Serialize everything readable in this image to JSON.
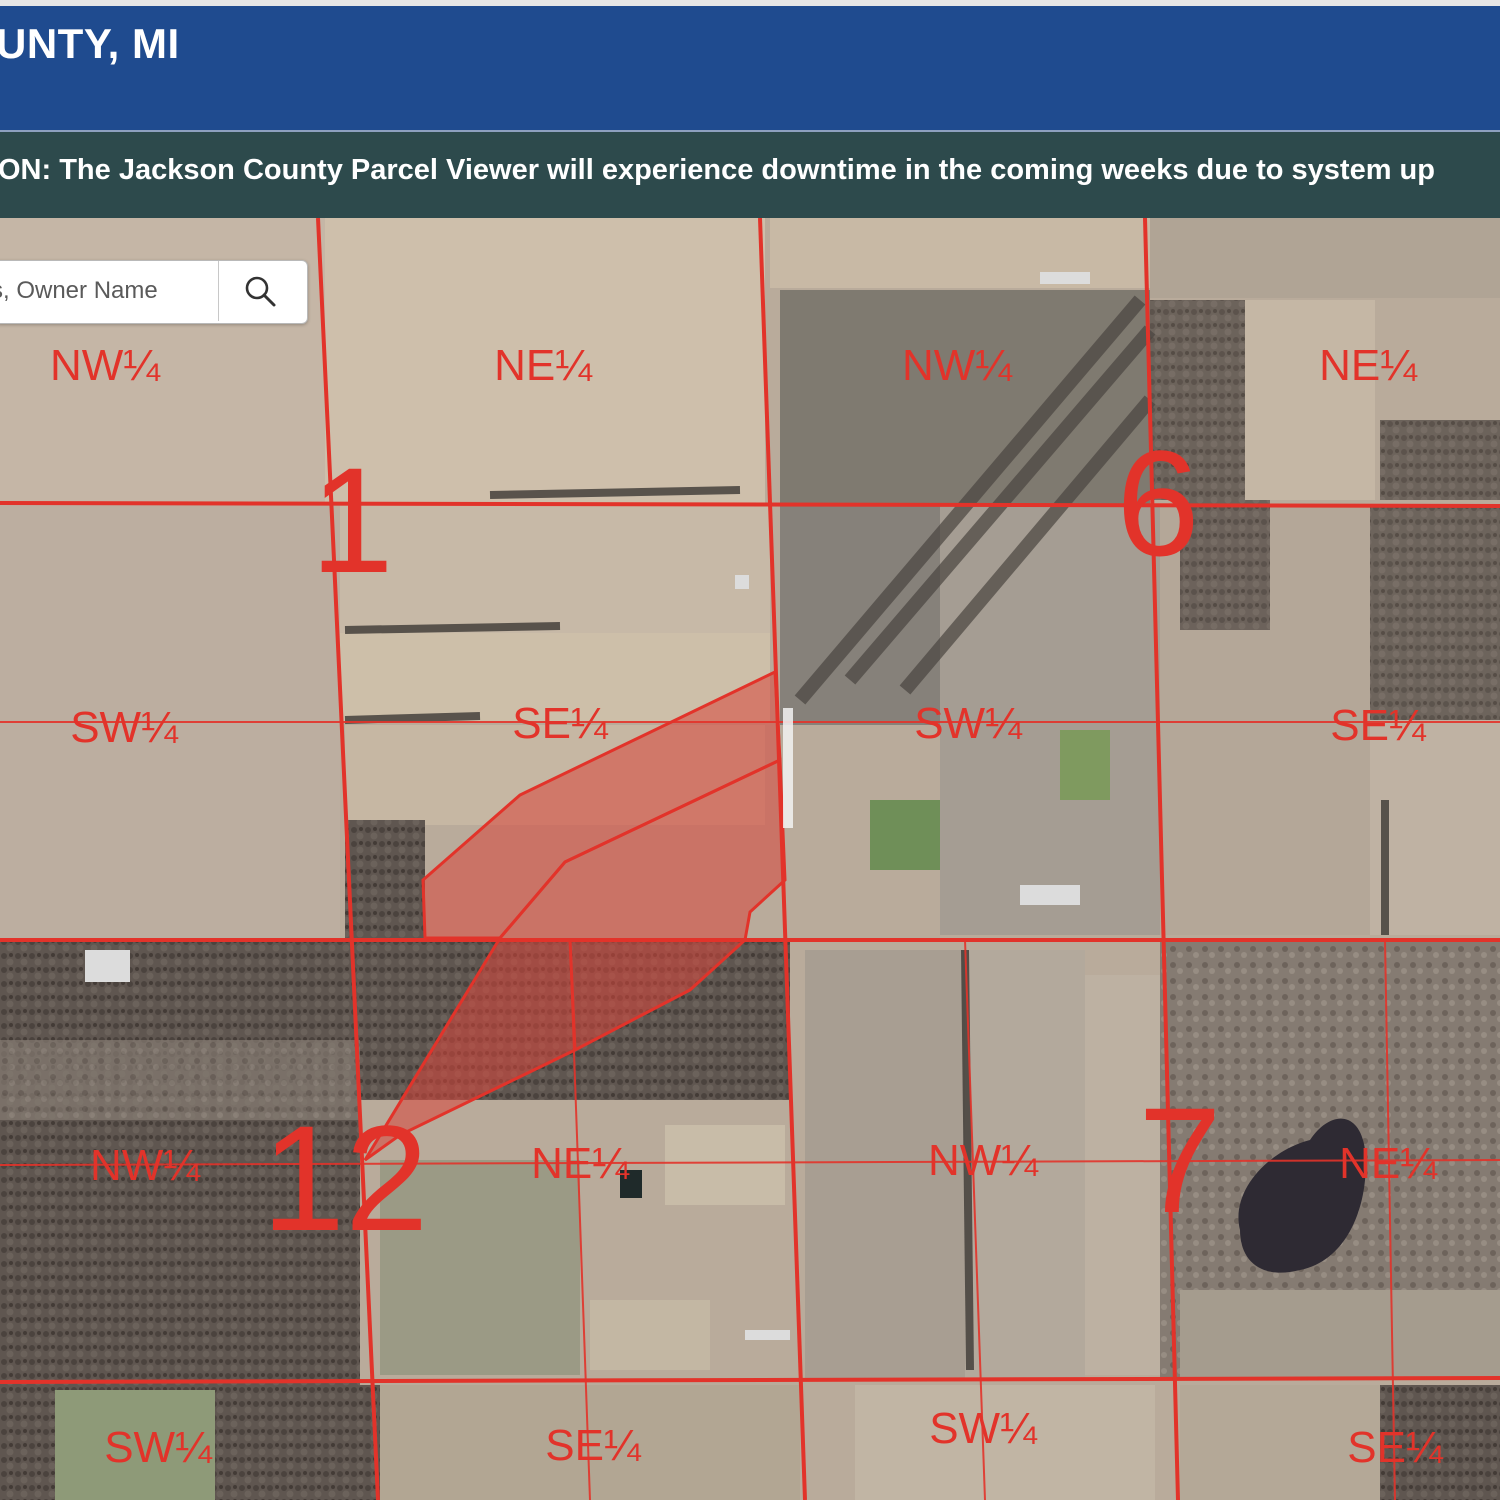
{
  "header": {
    "title": "UNTY, MI"
  },
  "notice": {
    "text": "ON: The Jackson County Parcel Viewer will experience downtime in the coming weeks due to system up"
  },
  "search": {
    "placeholder": "s, Owner Name"
  },
  "map": {
    "sections": [
      {
        "number": "1"
      },
      {
        "number": "6"
      },
      {
        "number": "12"
      },
      {
        "number": "7"
      }
    ],
    "quarter_labels": [
      "NW¼",
      "NE¼",
      "NW¼",
      "NE¼",
      "SW¼",
      "SE¼",
      "SW¼",
      "SE¼",
      "NW¼",
      "NE¼",
      "NW¼",
      "NE¼",
      "SW¼",
      "SE¼",
      "SW¼",
      "SE¼"
    ],
    "colors": {
      "section_line": "#e2332a",
      "selected_parcel_fill": "#d9453a",
      "label": "#e2332a"
    }
  }
}
